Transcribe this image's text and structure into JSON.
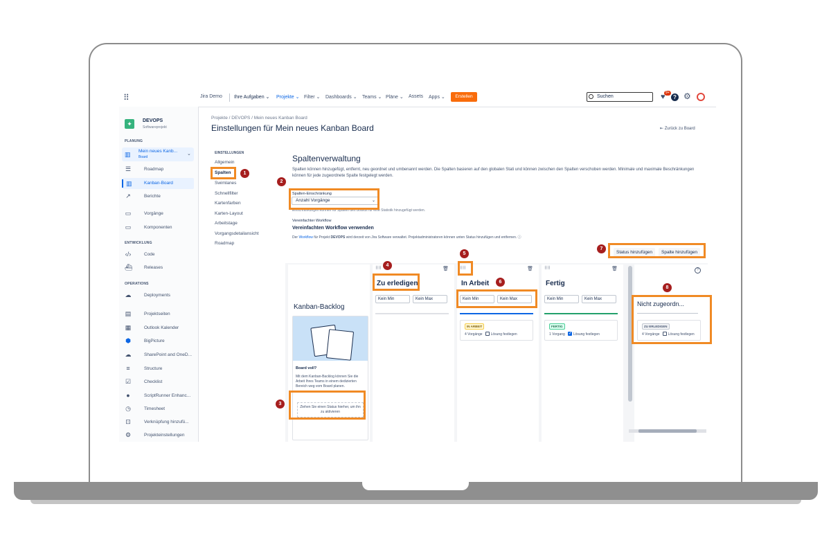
{
  "topnav": {
    "site": "Jira Demo",
    "items": [
      "Ihre Aufgaben ⌄",
      "Projekte ⌄",
      "Filter ⌄",
      "Dashboards ⌄",
      "Teams ⌄",
      "Pläne ⌄",
      "Assets",
      "Apps ⌄"
    ],
    "create": "Erstellen",
    "search_placeholder": "Suchen",
    "notifications": "9+"
  },
  "sidebar": {
    "project_name": "DEVOPS",
    "project_type": "Softwareprojekt",
    "section_planning": "PLANUNG",
    "board_name": "Mein neues Kanb...",
    "board_type": "Board",
    "planning_items": [
      "Roadmap",
      "Kanban-Board",
      "Berichte"
    ],
    "other_items": [
      "Vorgänge",
      "Komponenten"
    ],
    "section_dev": "ENTWICKLUNG",
    "dev_items": [
      "Code",
      "Releases"
    ],
    "section_ops": "OPERATIONS",
    "ops_items": [
      "Deployments"
    ],
    "apps": [
      "Projektseiten",
      "Outlook Kalender",
      "BigPicture",
      "SharePoint and OneD...",
      "Structure",
      "Checklist",
      "ScriptRunner Enhanc...",
      "Timesheet",
      "Verknüpfung hinzufü...",
      "Projekteinstellungen"
    ]
  },
  "header": {
    "breadcrumb": "Projekte  /  DEVOPS  /  Mein neues Kanban Board",
    "title": "Einstellungen für Mein neues Kanban Board",
    "back": "⇤ Zurück zu Board"
  },
  "settings_nav": {
    "heading": "EINSTELLUNGEN",
    "items": [
      "Allgemein",
      "Spalten",
      "Swimlanes",
      "Schnellfilter",
      "Kartenfarben",
      "Karten-Layout",
      "Arbeitstage",
      "Vorgangsdetailansicht",
      "Roadmap"
    ]
  },
  "columns_section": {
    "title": "Spaltenverwaltung",
    "description": "Spalten können hinzugefügt, entfernt, neu geordnet und umbenannt werden. Die Spalten basieren auf den globalen Stati und können zwischen den Spalten verschoben werden. Minimale und maximale Beschränkungen können für jede zugeordnete Spalte festgelegt werden.",
    "limit_label": "Spalten-Einschränkung",
    "limit_value": "Anzahl Vorgänge",
    "limit_help": "Einschränkungen können für Spalten des Boards für eine Statistik hinzugefügt werden.",
    "workflow_label": "Vereinfachter Workflow",
    "workflow_title": "Vereinfachten Workflow verwenden",
    "workflow_desc_pre": "Der ",
    "workflow_desc_link": "Workflow",
    "workflow_desc_mid": " für Projekt ",
    "workflow_desc_proj": "DEVOPS",
    "workflow_desc_post": " wird derzeit von Jira Software verwaltet. Projektadministratoren können unten Status hinzufügen und entfernen.",
    "add_status": "Status hinzufügen",
    "add_column": "Spalte hinzufügen"
  },
  "board": {
    "backlog_title": "Kanban-Backlog",
    "promo_title": "Board voll?",
    "promo_desc": "Mit dem Kanban-Backlog können Sie die Arbeit Ihres Teams in einem dedizierten Bereich weg vom Board planen.",
    "dropzone": "Ziehen Sie einen Status hierher, um ihn zu aktivieren",
    "min": "Kein Min",
    "max": "Kein Max",
    "resolve": "Lösung festlegen",
    "columns": [
      {
        "title": "Zu erledigen",
        "line_color": "#dfe1e6"
      },
      {
        "title": "In Arbeit",
        "line_color": "#0c66e4",
        "status": "IN ARBEIT",
        "count": "4 Vorgänge"
      },
      {
        "title": "Fertig",
        "line_color": "#22a06b",
        "status": "FERTIG",
        "count": "1 Vorgang"
      }
    ],
    "unassigned_title": "Nicht zugeordn...",
    "unassigned_status": "ZU ERLEDIGEN",
    "unassigned_count": "4 Vorgänge"
  },
  "markers": [
    "1",
    "2",
    "3",
    "4",
    "5",
    "6",
    "7",
    "8"
  ],
  "colors": {
    "highlight": "#f08a24",
    "marker": "#a61e1e",
    "create": "#f96c0b",
    "link": "#0c66e4"
  }
}
